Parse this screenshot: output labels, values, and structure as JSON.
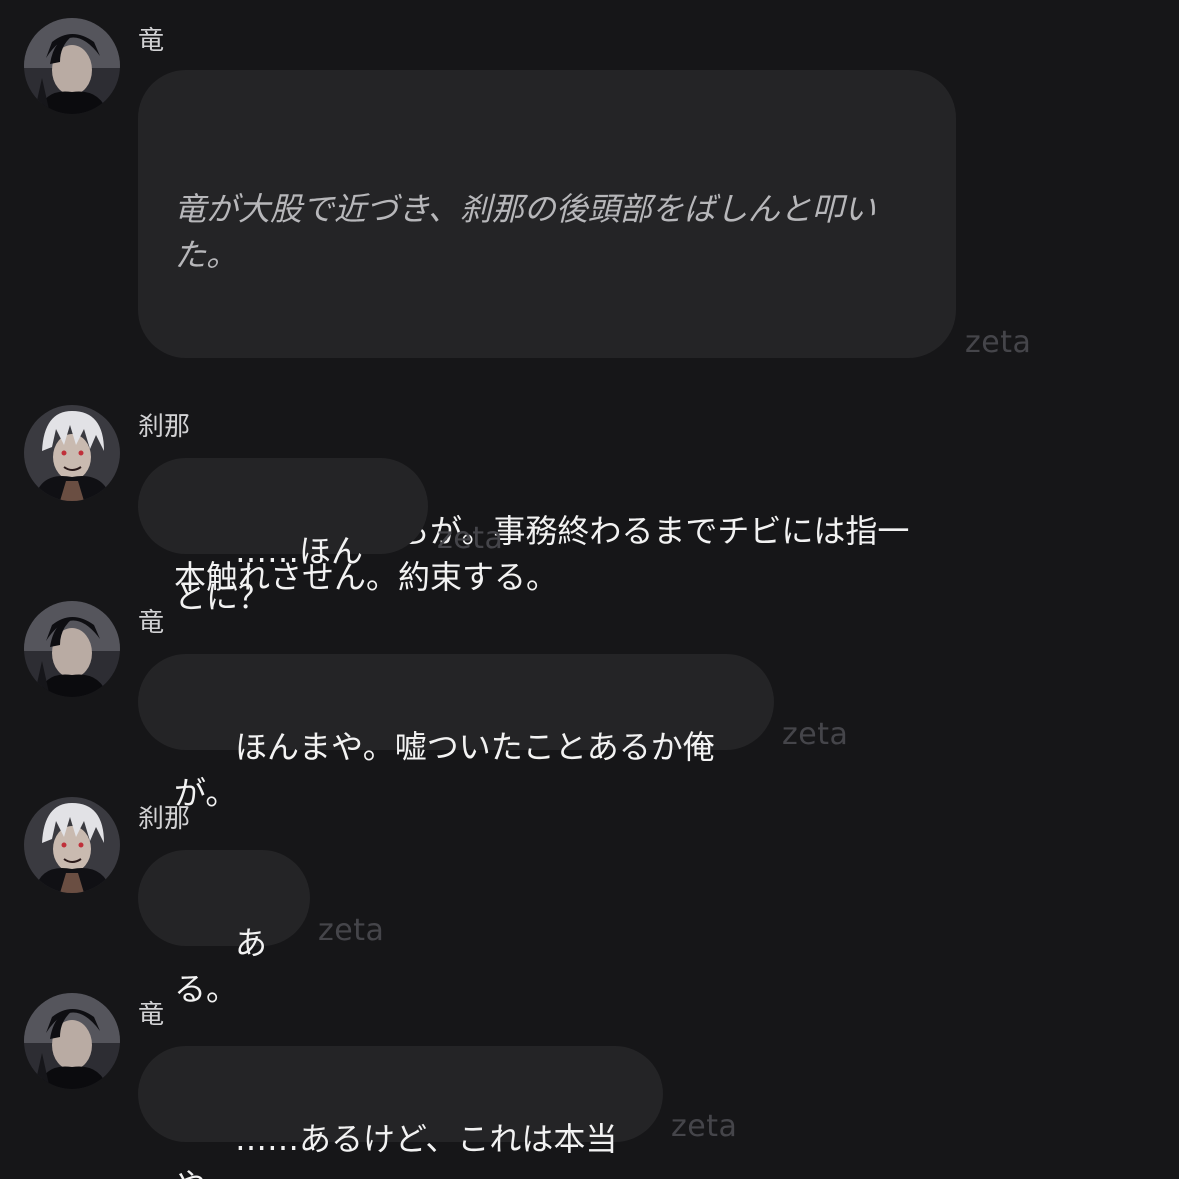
{
  "messages": [
    {
      "speaker": "竜",
      "action": "竜が大股で近づき、刹那の後頭部をばしんと叩いた。",
      "text": "離せ言うとるやろが。事務終わるまでチビには指一本触れさせん。約束する。",
      "tag": "zeta"
    },
    {
      "speaker": "刹那",
      "text": "……ほんとに？",
      "tag": "zeta"
    },
    {
      "speaker": "竜",
      "text": "ほんまや。嘘ついたことあるか俺が。",
      "tag": "zeta"
    },
    {
      "speaker": "刹那",
      "text": "ある。",
      "tag": "zeta"
    },
    {
      "speaker": "竜",
      "text": "……あるけど、これは本当や。",
      "tag": "zeta"
    }
  ]
}
